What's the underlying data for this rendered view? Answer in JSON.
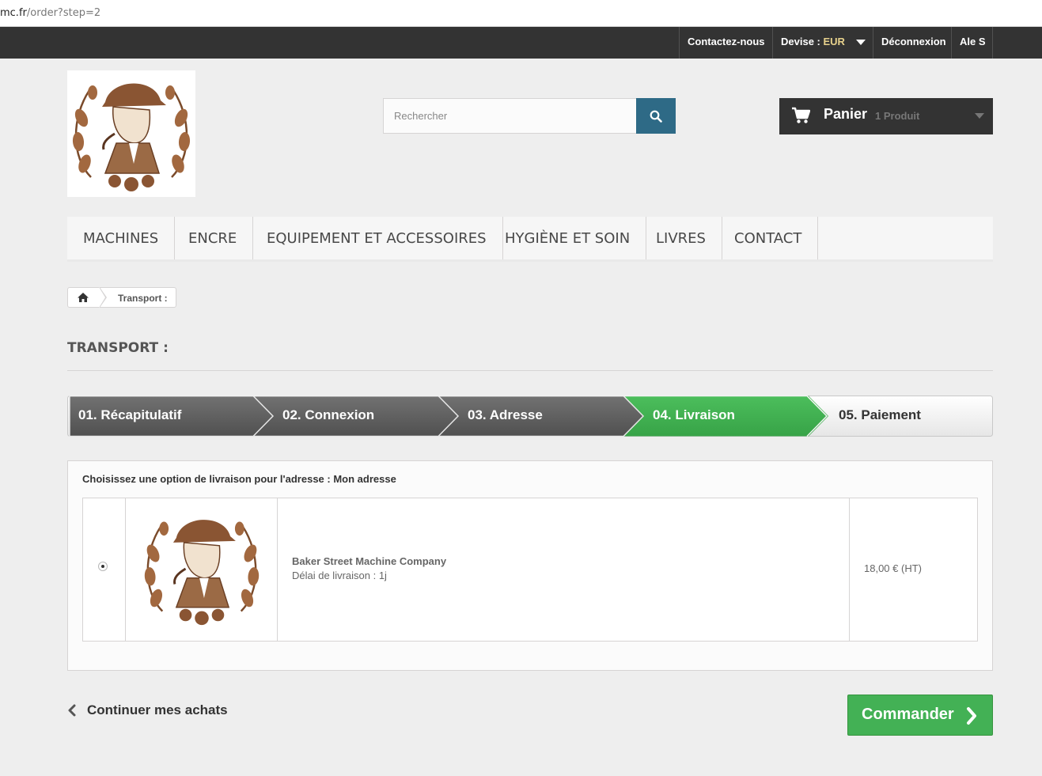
{
  "browser": {
    "url_host": "mc.fr",
    "url_path": "/order?step=2"
  },
  "topbar": {
    "contact": "Contactez-nous",
    "currency_label": "Devise :",
    "currency_value": "EUR",
    "logout": "Déconnexion",
    "user": "Ale S"
  },
  "search": {
    "placeholder": "Rechercher"
  },
  "cart": {
    "label": "Panier",
    "quantity": "1 Produit"
  },
  "menu": {
    "items": [
      "MACHINES",
      "ENCRE",
      "EQUIPEMENT ET ACCESSOIRES",
      "HYGIÈNE ET SOIN",
      "LIVRES",
      "CONTACT"
    ]
  },
  "breadcrumb": {
    "current": "Transport :"
  },
  "page": {
    "title": "TRANSPORT :"
  },
  "steps": [
    {
      "label": "01. Récapitulatif",
      "state": "done"
    },
    {
      "label": "02. Connexion",
      "state": "done"
    },
    {
      "label": "03. Adresse",
      "state": "done"
    },
    {
      "label": "04. Livraison",
      "state": "current"
    },
    {
      "label": "05. Paiement",
      "state": "todo"
    }
  ],
  "shipping": {
    "heading": "Choisissez une option de livraison pour l'adresse : Mon adresse",
    "carrier_name": "Baker Street Machine Company",
    "carrier_delay": "Délai de livraison : 1j",
    "price": "18,00 € (HT)",
    "selected": true
  },
  "footer": {
    "continue": "Continuer mes achats",
    "order": "Commander"
  },
  "colors": {
    "topbar": "#333333",
    "search_button": "#2e6a86",
    "step_done": "#5f5f5f",
    "step_current": "#43b155",
    "order_button": "#43b155"
  }
}
